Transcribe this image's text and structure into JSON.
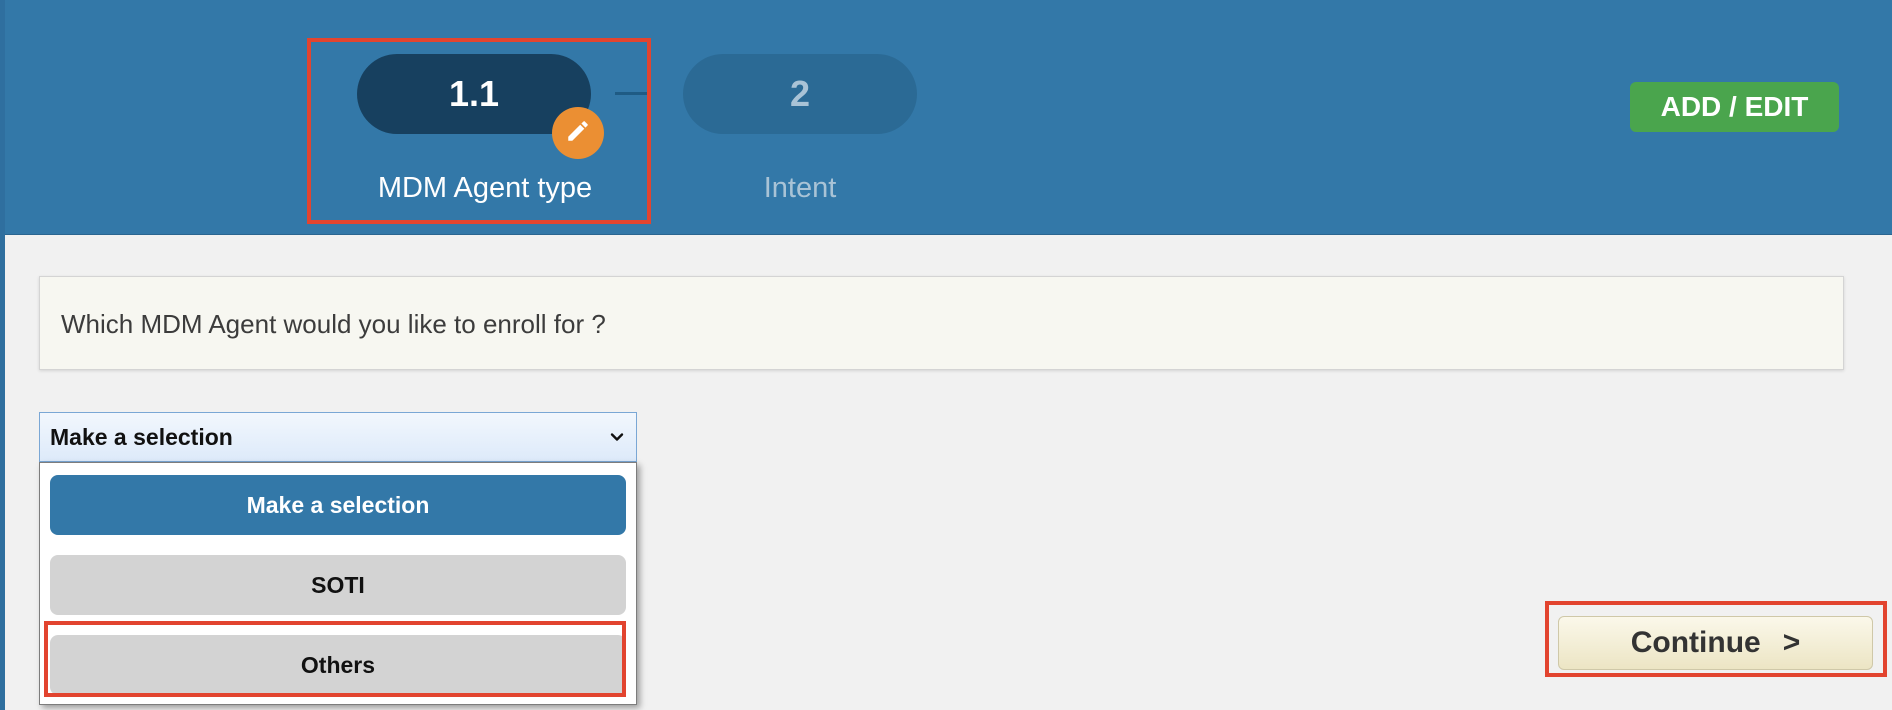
{
  "wizard": {
    "steps": [
      {
        "number": "1.1",
        "label": "MDM Agent type",
        "state": "active"
      },
      {
        "number": "2",
        "label": "Intent",
        "state": "inactive"
      }
    ],
    "edit_icon": "pencil-icon"
  },
  "header": {
    "add_edit_label": "ADD / EDIT"
  },
  "question": {
    "text": "Which MDM Agent would you like to enroll for ?"
  },
  "select": {
    "value": "Make a selection",
    "expanded": true,
    "chevron_icon": "chevron-down-icon",
    "options": [
      {
        "label": "Make a selection",
        "selected": true
      },
      {
        "label": "SOTI",
        "selected": false
      },
      {
        "label": "Others",
        "selected": false
      }
    ]
  },
  "continue": {
    "label": "Continue",
    "arrow": ">"
  },
  "colors": {
    "header_bg": "#3378a8",
    "active_step": "#17405f",
    "inactive_step": "#2b6a95",
    "edit_badge": "#eb8f33",
    "add_edit_bg": "#4aa54d",
    "highlight": "#e2442f",
    "option_selected": "#3378a8",
    "option_normal": "#d3d3d3"
  }
}
